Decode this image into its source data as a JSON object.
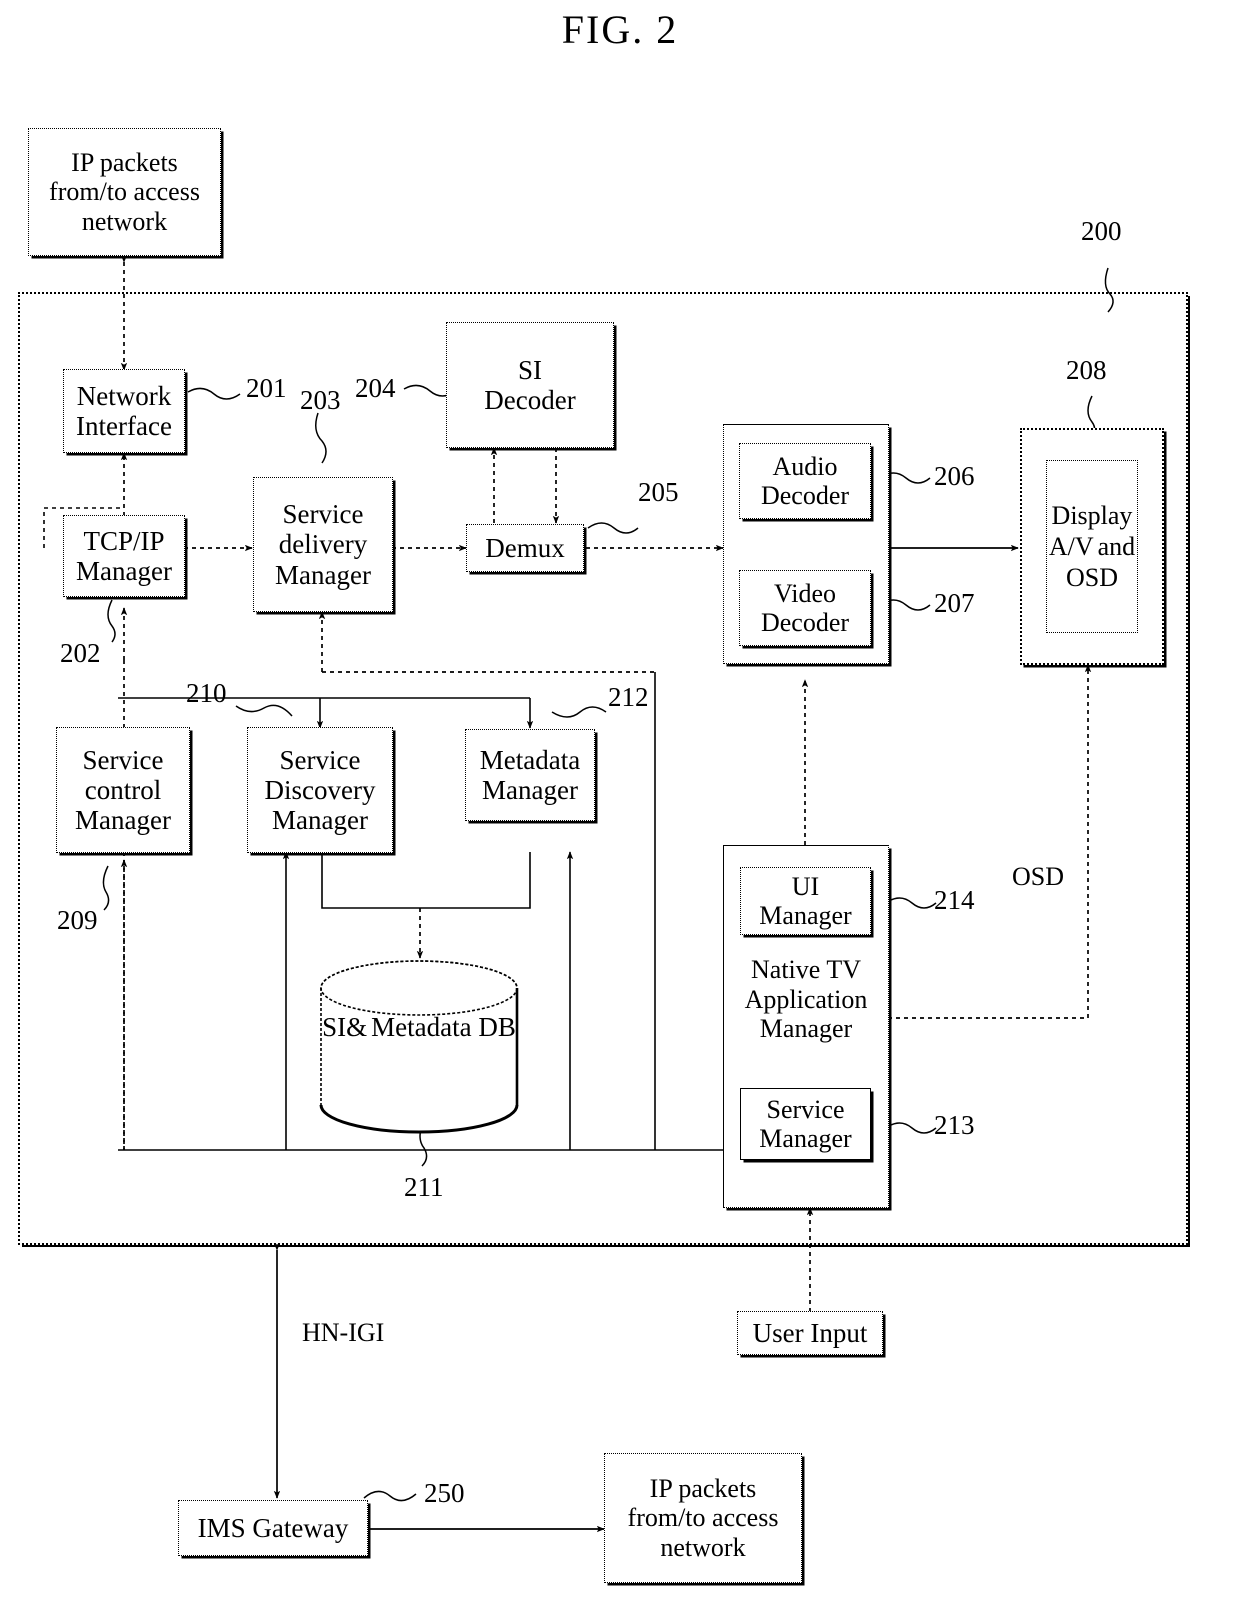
{
  "figure": {
    "title": "FIG. 2",
    "system_ref": "200"
  },
  "external_blocks": {
    "ip_packets_top": "IP packets\nfrom/to access\nnetwork",
    "ip_packets_top_l1": "IP packets",
    "ip_packets_top_l2": "from/to access",
    "ip_packets_top_l3": "network",
    "ip_packets_bottom_l1": "IP packets",
    "ip_packets_bottom_l2": "from/to access",
    "ip_packets_bottom_l3": "network",
    "user_input": "User Input",
    "ims_gateway": "IMS Gateway",
    "ims_gateway_ref": "250"
  },
  "blocks": [
    {
      "id": "network-interface",
      "label_l1": "Network",
      "label_l2": "Interface",
      "ref": "201"
    },
    {
      "id": "tcpip-manager",
      "label_l1": "TCP/IP",
      "label_l2": "Manager",
      "ref": "202"
    },
    {
      "id": "service-delivery-manager",
      "label_l1": "Service",
      "label_l2": "delivery",
      "label_l3": "Manager",
      "ref": "203"
    },
    {
      "id": "si-decoder",
      "label_l1": "SI",
      "label_l2": "Decoder",
      "ref": "204"
    },
    {
      "id": "demux",
      "label_l1": "Demux",
      "ref": "205"
    },
    {
      "id": "audio-decoder",
      "label_l1": "Audio",
      "label_l2": "Decoder",
      "ref": "206"
    },
    {
      "id": "video-decoder",
      "label_l1": "Video",
      "label_l2": "Decoder",
      "ref": "207"
    },
    {
      "id": "display-av-osd",
      "label_l1": "Display",
      "label_l2": "A/V",
      "label_l3": "and",
      "label_l4": "OSD",
      "ref": "208"
    },
    {
      "id": "service-control-manager",
      "label_l1": "Service",
      "label_l2": "control",
      "label_l3": "Manager",
      "ref": "209"
    },
    {
      "id": "service-discovery-manager",
      "label_l1": "Service",
      "label_l2": "Discovery",
      "label_l3": "Manager",
      "ref": "210"
    },
    {
      "id": "si-metadata-db",
      "label_l1": "SI&",
      "label_l2": "Metadata DB",
      "ref": "211"
    },
    {
      "id": "metadata-manager",
      "label_l1": "Metadata",
      "label_l2": "Manager",
      "ref": "212"
    },
    {
      "id": "service-manager",
      "label_l1": "Service",
      "label_l2": "Manager",
      "ref": "213"
    },
    {
      "id": "ui-manager",
      "label_l1": "UI",
      "label_l2": "Manager",
      "ref": "214"
    }
  ],
  "groups": {
    "native_tv_app_manager_l1": "Native TV",
    "native_tv_app_manager_l2": "Application",
    "native_tv_app_manager_l3": "Manager"
  },
  "annotations": {
    "osd": "OSD",
    "hn_igi": "HN-IGI"
  },
  "colors": {
    "ink": "#000000",
    "paper": "#ffffff"
  }
}
